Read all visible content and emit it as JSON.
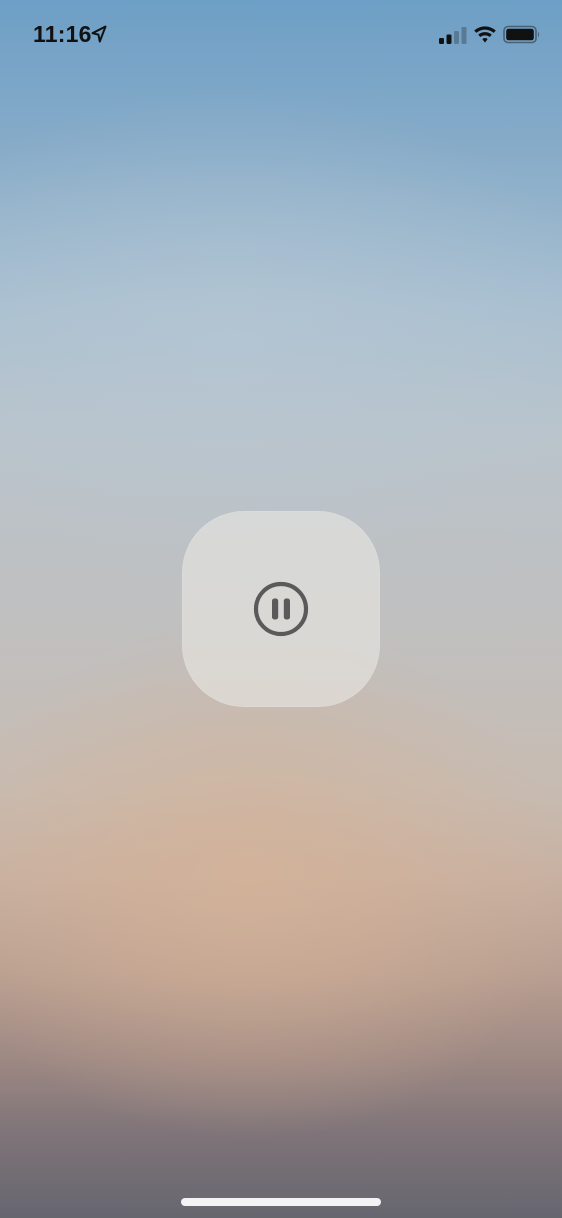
{
  "status_bar": {
    "time": "11:16",
    "icons": {
      "location": "location-arrow-icon",
      "signal": "cellular-signal-icon",
      "wifi": "wifi-icon",
      "battery": "battery-full-icon"
    },
    "signal_bars_active": 2,
    "signal_bars_total": 4,
    "battery_level": 1.0
  },
  "overlay": {
    "icon": "pause-circle-icon",
    "state": "paused"
  },
  "colors": {
    "status_text": "#111111",
    "tile_background": "#e8e6e2",
    "icon_stroke": "#5a5a5a",
    "home_indicator": "#ffffff"
  }
}
